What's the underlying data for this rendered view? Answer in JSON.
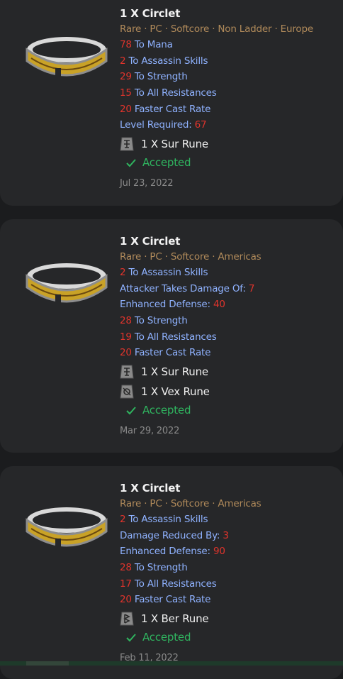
{
  "colors": {
    "meta": "#b08a5a",
    "stat": "#8fb2ff",
    "num": "#e0342c",
    "accepted": "#2fb45f"
  },
  "orders": [
    {
      "title": "1 X Circlet",
      "meta": "Rare · PC · Softcore · Non Ladder · Europe",
      "stats": [
        {
          "num": "78",
          "text": " To Mana"
        },
        {
          "num": "2",
          "text": " To Assassin Skills"
        },
        {
          "num": "29",
          "text": " To Strength"
        },
        {
          "num": "15",
          "text": " To All Resistances"
        },
        {
          "num": "20",
          "text": " Faster Cast Rate"
        },
        {
          "text": "Level Required: ",
          "num": "67"
        }
      ],
      "runes": [
        {
          "label": "1 X Sur Rune",
          "icon": "sur-rune-icon"
        }
      ],
      "status": "Accepted",
      "date": "Jul 23, 2022"
    },
    {
      "title": "1 X Circlet",
      "meta": "Rare · PC · Softcore · Americas",
      "stats": [
        {
          "num": "2",
          "text": " To Assassin Skills"
        },
        {
          "text": "Attacker Takes Damage Of: ",
          "num": "7"
        },
        {
          "text": "Enhanced Defense: ",
          "num": "40"
        },
        {
          "num": "28",
          "text": " To Strength"
        },
        {
          "num": "19",
          "text": " To All Resistances"
        },
        {
          "num": "20",
          "text": " Faster Cast Rate"
        }
      ],
      "runes": [
        {
          "label": "1 X Sur Rune",
          "icon": "sur-rune-icon"
        },
        {
          "label": "1 X Vex Rune",
          "icon": "vex-rune-icon"
        }
      ],
      "status": "Accepted",
      "date": "Mar 29, 2022"
    },
    {
      "title": "1 X Circlet",
      "meta": "Rare · PC · Softcore · Americas",
      "stats": [
        {
          "num": "2",
          "text": " To Assassin Skills"
        },
        {
          "text": "Damage Reduced By: ",
          "num": "3"
        },
        {
          "text": "Enhanced Defense: ",
          "num": "90"
        },
        {
          "num": "28",
          "text": " To Strength"
        },
        {
          "num": "17",
          "text": " To All Resistances"
        },
        {
          "num": "20",
          "text": " Faster Cast Rate"
        }
      ],
      "runes": [
        {
          "label": "1 X Ber Rune",
          "icon": "ber-rune-icon"
        }
      ],
      "status": "Accepted",
      "date": "Feb 11, 2022"
    }
  ]
}
